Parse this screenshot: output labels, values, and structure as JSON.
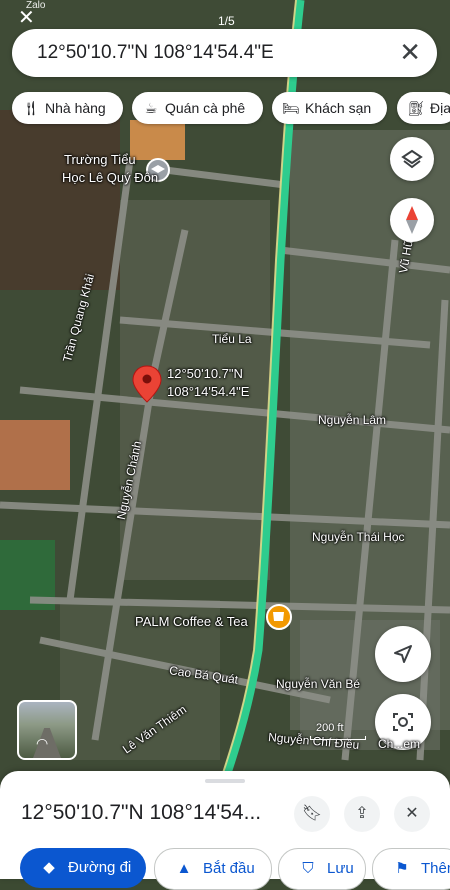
{
  "status": {
    "app_back": "Zalo",
    "page_indicator": "1/5"
  },
  "search": {
    "query": "12°50'10.7\"N 108°14'54.4\"E",
    "close_label": "✕"
  },
  "chips": [
    {
      "icon": "restaurant-icon",
      "label": "Nhà hàng"
    },
    {
      "icon": "coffee-icon",
      "label": "Quán cà phê"
    },
    {
      "icon": "hotel-icon",
      "label": "Khách sạn"
    },
    {
      "icon": "gas-icon",
      "label": "Địa"
    }
  ],
  "map": {
    "pin_label_line1": "12°50'10.7\"N",
    "pin_label_line2": "108°14'54.4\"E",
    "poi_school_line1": "Trường Tiểu",
    "poi_school_line2": "Học Lê Quý Đôn",
    "poi_cafe": "PALM Coffee & Tea",
    "streets": {
      "tieu_la": "Tiểu La",
      "tran_quang_khai": "Trần Quang Khải",
      "nguyen_lam": "Nguyễn Lâm",
      "nguyen_chanh": "Nguyễn Chánh",
      "nguyen_thai_hoc": "Nguyễn Thái Học",
      "cao_ba_quat": "Cao Bá Quát",
      "nguyen_van_be": "Nguyễn Văn Bé",
      "le_van_thiem": "Lê Văn Thiêm",
      "nguyen_chi_dieu": "Nguyễn Chí Điều",
      "vu_huu": "Vũ Hữu"
    },
    "scale_label": "200 ft",
    "camera_label": "Ch...em"
  },
  "sheet": {
    "title": "12°50'10.7\"N 108°14'54...",
    "actions": [
      {
        "icon": "directions-icon",
        "label": "Đường đi"
      },
      {
        "icon": "navigation-icon",
        "label": "Bắt đầu"
      },
      {
        "icon": "bookmark-icon",
        "label": "Lưu"
      },
      {
        "icon": "flag-icon",
        "label": "Thêm"
      }
    ]
  },
  "colors": {
    "route_green": "#2ecc8e",
    "pin_red": "#ea4335",
    "action_blue": "#0b57d0",
    "poi_orange": "#f29900"
  }
}
